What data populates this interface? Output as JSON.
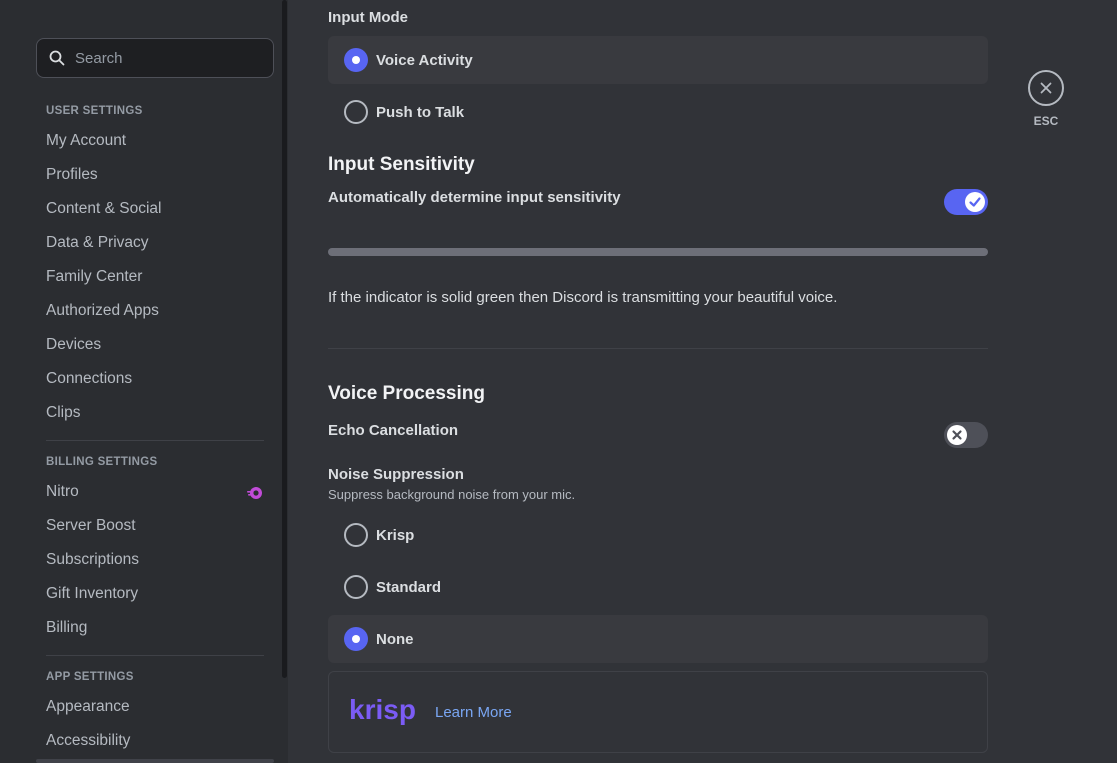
{
  "search": {
    "placeholder": "Search"
  },
  "sidebar": {
    "user_settings_header": "USER SETTINGS",
    "user_items": [
      "My Account",
      "Profiles",
      "Content & Social",
      "Data & Privacy",
      "Family Center",
      "Authorized Apps",
      "Devices",
      "Connections",
      "Clips"
    ],
    "billing_settings_header": "BILLING SETTINGS",
    "billing_items": [
      "Nitro",
      "Server Boost",
      "Subscriptions",
      "Gift Inventory",
      "Billing"
    ],
    "app_settings_header": "APP SETTINGS",
    "app_items": [
      "Appearance",
      "Accessibility"
    ]
  },
  "main": {
    "input_mode_label": "Input Mode",
    "input_modes": [
      {
        "label": "Voice Activity",
        "selected": true
      },
      {
        "label": "Push to Talk",
        "selected": false
      }
    ],
    "input_sensitivity_heading": "Input Sensitivity",
    "auto_sensitivity_label": "Automatically determine input sensitivity",
    "auto_sensitivity_enabled": true,
    "indicator_text": "If the indicator is solid green then Discord is transmitting your beautiful voice.",
    "voice_processing_heading": "Voice Processing",
    "echo_cancellation_label": "Echo Cancellation",
    "echo_cancellation_enabled": false,
    "noise_suppression_label": "Noise Suppression",
    "noise_suppression_desc": "Suppress background noise from your mic.",
    "noise_options": [
      {
        "label": "Krisp",
        "selected": false
      },
      {
        "label": "Standard",
        "selected": false
      },
      {
        "label": "None",
        "selected": true
      }
    ],
    "krisp_logo_text": "krisp",
    "learn_more": "Learn More"
  },
  "close": {
    "label": "ESC"
  },
  "colors": {
    "accent": "#5865f2",
    "background": "#313338",
    "sidebar": "#2b2d31",
    "krisp_brand": "#7b5cf5",
    "nitro_badge": "#c14bd8"
  }
}
